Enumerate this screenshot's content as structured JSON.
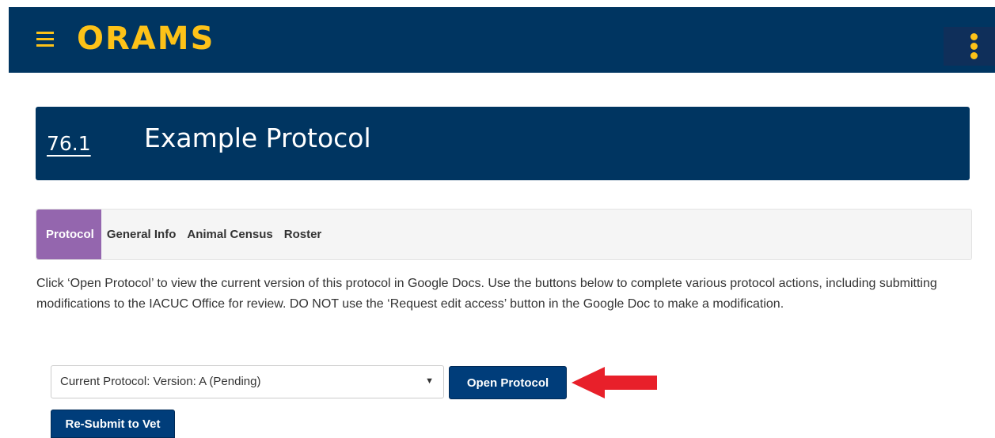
{
  "app": {
    "brand": "ORAMS"
  },
  "protocol": {
    "number": "76.1",
    "title": "Example Protocol"
  },
  "tabs": [
    {
      "label": "Protocol",
      "active": true
    },
    {
      "label": "General Info",
      "active": false
    },
    {
      "label": "Animal Census",
      "active": false
    },
    {
      "label": "Roster",
      "active": false
    }
  ],
  "intro_text": "Click ‘Open Protocol’ to view the current version of this protocol in Google Docs. Use the buttons below to complete various protocol actions, including submitting modifications to the IACUC Office for review. DO NOT use the ‘Request edit access’ button in the Google Doc to make a modification.",
  "version_select": {
    "selected": "Current Protocol: Version: A (Pending)"
  },
  "buttons": {
    "open_protocol": "Open Protocol",
    "resubmit_vet": "Re-Submit to Vet"
  },
  "icons": {
    "menu": "hamburger-menu-icon",
    "more": "kebab-vertical-icon",
    "caret": "chevron-down-icon",
    "annotation": "red-arrow-left"
  },
  "colors": {
    "navy": "#003561",
    "gold": "#fdc218",
    "tab_active": "#9466ae",
    "button": "#003d7a",
    "arrow": "#e8202a"
  }
}
